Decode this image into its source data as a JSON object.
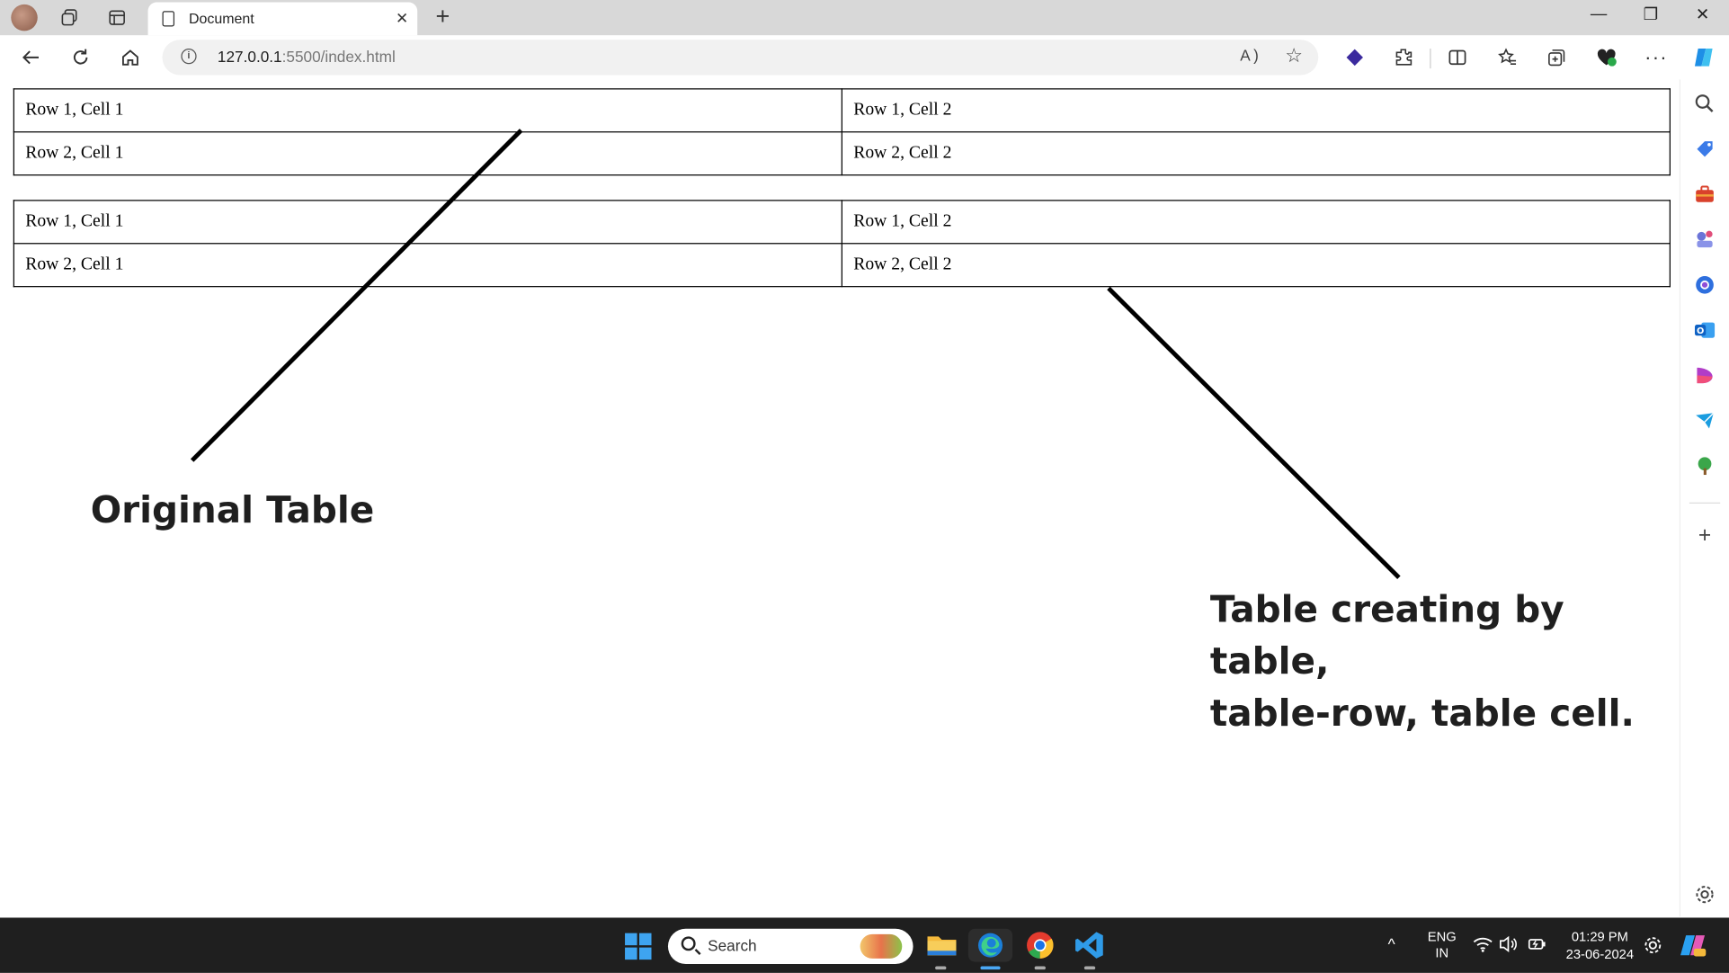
{
  "browser": {
    "tab_title": "Document",
    "url_host": "127.0.0.1",
    "url_path": ":5500/index.html",
    "read_aloud_label": "A )",
    "more_label": "···"
  },
  "page": {
    "tables": [
      {
        "rows": [
          [
            "Row 1, Cell 1",
            "Row 1, Cell 2"
          ],
          [
            "Row 2, Cell 1",
            "Row 2, Cell 2"
          ]
        ]
      },
      {
        "rows": [
          [
            "Row 1, Cell 1",
            "Row 1, Cell 2"
          ],
          [
            "Row 2, Cell 1",
            "Row 2, Cell 2"
          ]
        ]
      }
    ],
    "annotation_original": "Original Table",
    "annotation_created_line1": "Table creating by table,",
    "annotation_created_line2": "table-row, table cell."
  },
  "taskbar": {
    "search_placeholder": "Search",
    "lang_top": "ENG",
    "lang_bottom": "IN",
    "time": "01:29 PM",
    "date": "23-06-2024"
  },
  "colors": {
    "taskbar_bg": "#1f1f1f",
    "windows_blue": "#3ea4f0",
    "edge_accent": "#2f6de0"
  },
  "icons": [
    "back-icon",
    "refresh-icon",
    "home-icon",
    "info-icon",
    "read-aloud-icon",
    "favorite-star-icon",
    "extension-icon",
    "split-screen-icon",
    "favorites-icon",
    "collections-icon",
    "more-icon",
    "copilot-icon",
    "search-icon",
    "settings-icon",
    "windows-icon",
    "file-explorer-icon",
    "edge-icon",
    "chrome-icon",
    "vscode-icon",
    "wifi-icon",
    "volume-icon",
    "battery-icon"
  ]
}
